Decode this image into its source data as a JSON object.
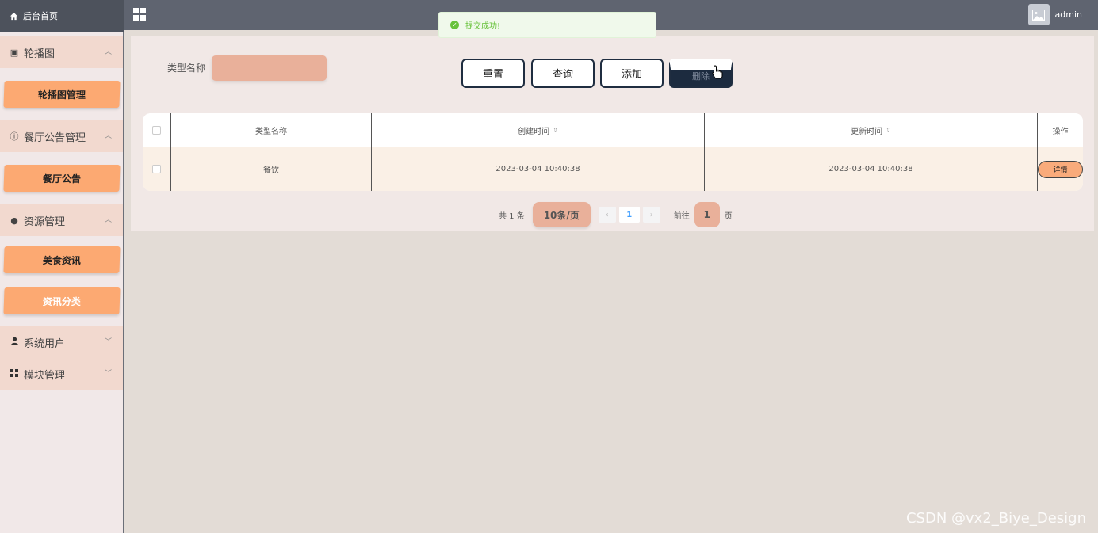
{
  "header": {
    "home_label": "后台首页",
    "title": "",
    "user_name": "admin"
  },
  "toast": {
    "message": "提交成功!"
  },
  "sidebar": {
    "groups": [
      {
        "label": "轮播图",
        "icon": "image-icon",
        "items": [
          "轮播图管理"
        ]
      },
      {
        "label": "餐厅公告管理",
        "icon": "info-icon",
        "items": [
          "餐厅公告"
        ]
      },
      {
        "label": "资源管理",
        "icon": "location-icon",
        "items": [
          "美食资讯",
          "资讯分类"
        ]
      },
      {
        "label": "系统用户",
        "icon": "user-icon",
        "items": []
      },
      {
        "label": "模块管理",
        "icon": "grid-icon",
        "items": []
      }
    ]
  },
  "search": {
    "label": "类型名称",
    "value": ""
  },
  "toolbar": {
    "reset": "重置",
    "query": "查询",
    "add": "添加",
    "delete": "删除"
  },
  "table": {
    "columns": [
      "类型名称",
      "创建时间",
      "更新时间",
      "操作"
    ],
    "rows": [
      {
        "name": "餐饮",
        "created": "2023-03-04 10:40:38",
        "updated": "2023-03-04 10:40:38",
        "action": "详情"
      }
    ]
  },
  "pagination": {
    "total": "共 1 条",
    "page_size": "10条/页",
    "current": "1",
    "goto_label": "前往",
    "goto_value": "1",
    "goto_suffix": "页"
  },
  "watermark": "CSDN @vx2_Biye_Design",
  "colors": {
    "accent": "#fca972",
    "input_bg": "#e9b09a",
    "header_bg": "#5f6470",
    "dark_button": "#1c2b3f",
    "success": "#67c23a"
  }
}
